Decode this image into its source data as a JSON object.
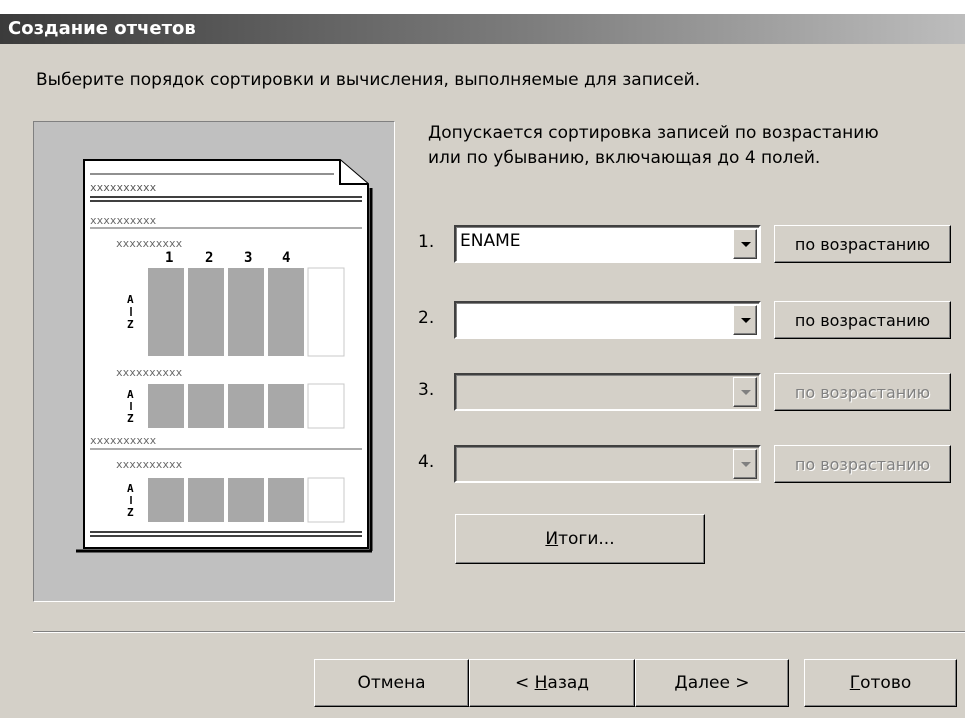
{
  "top_text": "",
  "window": {
    "title": "Создание отчетов"
  },
  "instruction": "Выберите порядок сортировки и вычисления, выполняемые для записей.",
  "description": {
    "line1": "Допускается сортировка записей по возрастанию",
    "line2": "или по убыванию, включающая до 4 полей."
  },
  "sort_fields": [
    {
      "number": "1.",
      "value": "ENAME",
      "order_label": "по возрастанию",
      "enabled": true
    },
    {
      "number": "2.",
      "value": "",
      "order_label": "по возрастанию",
      "enabled": true
    },
    {
      "number": "3.",
      "value": "",
      "order_label": "по возрастанию",
      "enabled": false
    },
    {
      "number": "4.",
      "value": "",
      "order_label": "по возрастанию",
      "enabled": false
    }
  ],
  "summary_button": {
    "accel": "И",
    "rest": "тоги..."
  },
  "footer": {
    "cancel": "Отмена",
    "back": {
      "prefix": "< ",
      "accel": "Н",
      "rest": "азад"
    },
    "next": {
      "accel": "Д",
      "rest": "алее >"
    },
    "finish": {
      "accel": "Г",
      "rest": "отово"
    }
  },
  "preview": {
    "placeholder": "xxxxxxxxxx",
    "column_numbers": [
      "1",
      "2",
      "3",
      "4"
    ],
    "cell_text": "xxxx",
    "sort_glyph_top": "A",
    "sort_glyph_bottom": "Z"
  }
}
